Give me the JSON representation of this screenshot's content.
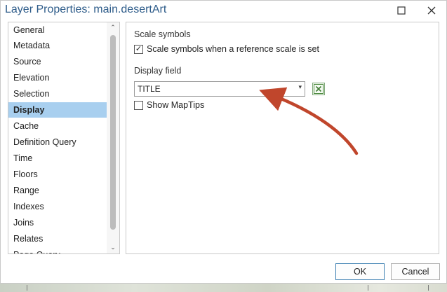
{
  "window": {
    "title": "Layer Properties: main.desertArt",
    "minimize_icon": "maximize-icon",
    "close_icon": "close-icon"
  },
  "sidebar": {
    "items": [
      {
        "label": "General"
      },
      {
        "label": "Metadata"
      },
      {
        "label": "Source"
      },
      {
        "label": "Elevation"
      },
      {
        "label": "Selection"
      },
      {
        "label": "Display",
        "selected": true
      },
      {
        "label": "Cache"
      },
      {
        "label": "Definition Query"
      },
      {
        "label": "Time"
      },
      {
        "label": "Floors"
      },
      {
        "label": "Range"
      },
      {
        "label": "Indexes"
      },
      {
        "label": "Joins"
      },
      {
        "label": "Relates"
      },
      {
        "label": "Page Query"
      }
    ],
    "selected_color": "#a8cfef"
  },
  "display": {
    "scale_symbols_heading": "Scale symbols",
    "scale_symbols_checkbox_label": "Scale symbols when a reference scale is set",
    "scale_symbols_checked": true,
    "display_field_heading": "Display field",
    "display_field_value": "TITLE",
    "expression_icon": "expression-x-icon",
    "show_maptips_label": "Show MapTips",
    "show_maptips_checked": false
  },
  "buttons": {
    "ok_label": "OK",
    "cancel_label": "Cancel"
  },
  "colors": {
    "title": "#2e5c8a",
    "annotation_arrow": "#c0462c"
  }
}
